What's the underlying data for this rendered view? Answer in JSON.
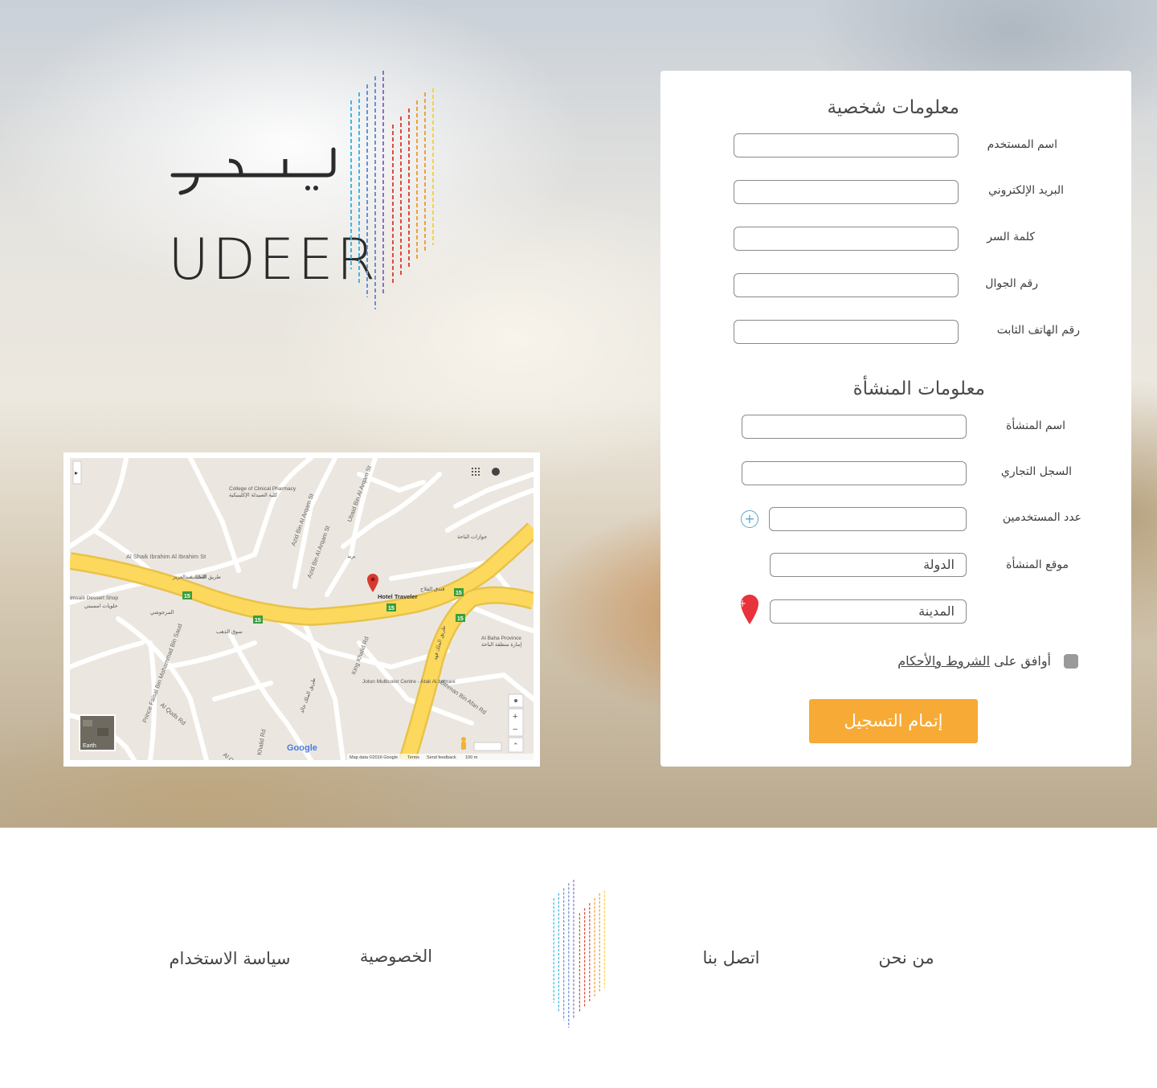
{
  "brand": {
    "name_ar": "يديـر",
    "name_en": "UDEER",
    "logo_colors": [
      "#3fb7e6",
      "#6a8fd6",
      "#8a6fc9",
      "#e04a3c",
      "#f0a03a",
      "#f3d24a"
    ]
  },
  "personal_info": {
    "title": "معلومات شخصية",
    "fields": [
      {
        "label": "اسم المستخدم",
        "value": "",
        "placeholder": ""
      },
      {
        "label": "البريد الإلكتروني",
        "value": "",
        "placeholder": ""
      },
      {
        "label": "كلمة السر",
        "value": "",
        "placeholder": ""
      },
      {
        "label": "رقم الجوال",
        "value": "",
        "placeholder": ""
      },
      {
        "label": "رقم الهاتف الثابت",
        "value": "",
        "placeholder": ""
      }
    ]
  },
  "business_info": {
    "title": "معلومات المنشأة",
    "name_label": "اسم المنشأة",
    "commercial_register_label": "السجل التجاري",
    "users_count_label": "عدد المستخدمين",
    "add_icon": "plus-circle-icon",
    "location_label": "موقع المنشأة",
    "country_value": "الدولة",
    "city_value": "المدينة",
    "location_pin_icon": "map-pin-plus-icon",
    "pin_color": "#e8323c"
  },
  "terms": {
    "prefix": "أوافق على",
    "link_text": "الشروط والأحكام"
  },
  "submit_label": "إتمام التسجيل",
  "accent_color": "#f7aa35",
  "map": {
    "place_label": "Hotel Traveler",
    "streets": [
      "Al Shaik Ibrahim Al Ibrahim St",
      "Azid Bin Al Arqam St",
      "Ubaid Bin Al Arqam St",
      "Azid Bin Al Arqam St",
      "King Khalid Rd",
      "Othman Bin Afan Rd",
      "Prince Faisal Bin Mohammad Bin Saud",
      "Al Quds Rd",
      "Al Quds Rd",
      "Khalid Rd"
    ],
    "pois": [
      "College of Clinical Pharmacy",
      "كلية الصيدلة الإكلينيكية",
      "Al Baha Province",
      "إمارة منطقة الباحة",
      "Jotun Multicolor Centre - Atak Al zahrani",
      "Imsaiti Dessert Shop",
      "حلويات امسيتي"
    ],
    "arabic_labels": [
      "طريق الملك عبدالعزيز",
      "طريق الملك فهد",
      "طريق الملك خالد",
      "سوق الذهب",
      "المرجوشي",
      "الاحباب",
      "فندق الفلاح",
      "جوازات الباحة",
      "بريد"
    ],
    "route_badges": [
      "15",
      "15",
      "15",
      "15",
      "15"
    ],
    "satellite_label": "Earth",
    "google_logo": "Google",
    "attribution": "Map data ©2016 Google",
    "terms_link": "Terms",
    "feedback_link": "Send feedback",
    "scale": "100 m",
    "zoom_in": "+",
    "zoom_out": "−",
    "icons": [
      "sidebar-toggle-icon",
      "apps-grid-icon",
      "account-icon",
      "my-location-icon",
      "pegman-icon",
      "map-pin-icon",
      "expand-icon"
    ]
  },
  "footer": {
    "links": [
      "من نحن",
      "اتصل بنا",
      "الخصوصية",
      "سياسة الاستخدام"
    ]
  }
}
